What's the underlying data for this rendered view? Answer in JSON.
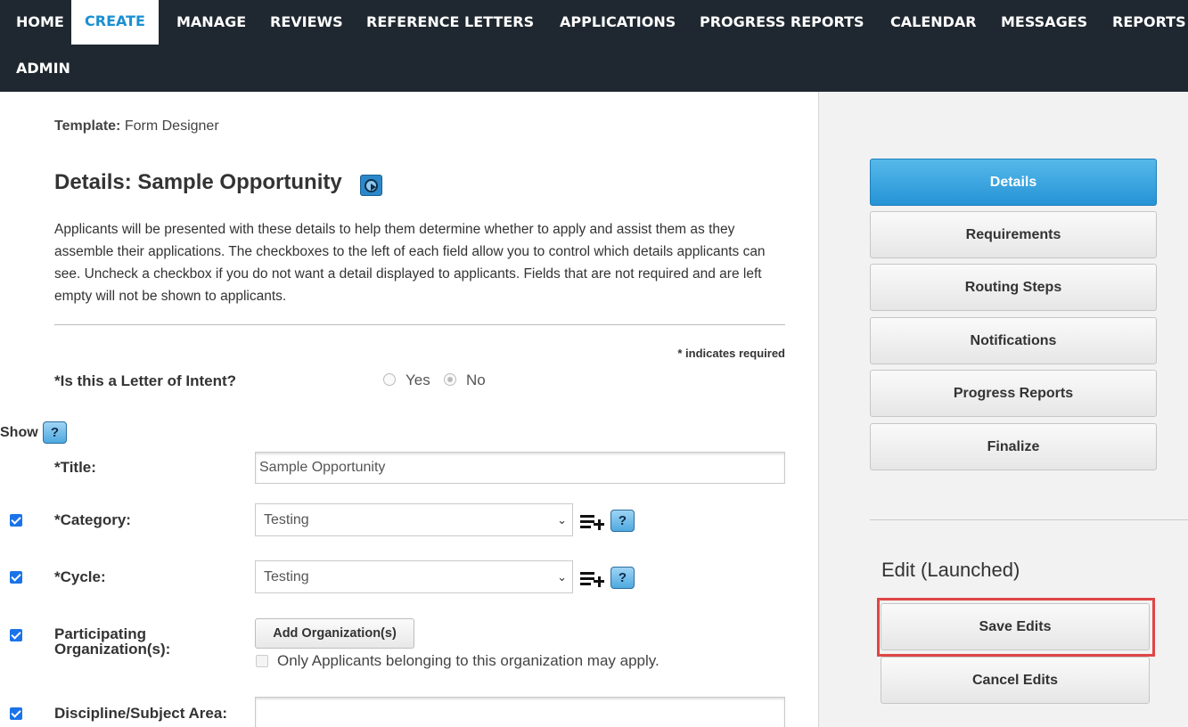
{
  "nav": {
    "items": [
      "HOME",
      "CREATE",
      "MANAGE",
      "REVIEWS",
      "REFERENCE LETTERS",
      "APPLICATIONS",
      "PROGRESS REPORTS",
      "CALENDAR",
      "MESSAGES",
      "REPORTS",
      "ADMIN"
    ],
    "active": "CREATE"
  },
  "header": {
    "template_label": "Template:",
    "template_value": "Form Designer",
    "title": "Details: Sample Opportunity"
  },
  "description": "Applicants will be presented with these details to help them determine whether to apply and assist them as they assemble their applications. The checkboxes to the left of each field allow you to control which details applicants can see. Uncheck a checkbox if you do not want a detail displayed to applicants. Fields that are not required and are left empty will not be shown to applicants.",
  "required_note": "* indicates required",
  "letter_of_intent": {
    "label": "*Is this a Letter of Intent?",
    "options": [
      "Yes",
      "No"
    ],
    "selected": "No"
  },
  "show_label": "Show",
  "help_glyph": "?",
  "fields": {
    "title": {
      "label": "*Title:",
      "value": "Sample Opportunity"
    },
    "category": {
      "label": "*Category:",
      "value": "Testing",
      "show": true
    },
    "cycle": {
      "label": "*Cycle:",
      "value": "Testing",
      "show": true
    },
    "participating_orgs": {
      "label_line1": "Participating",
      "label_line2": "Organization(s):",
      "button": "Add Organization(s)",
      "restriction_label": "Only Applicants belonging to this organization may apply.",
      "restriction_checked": false,
      "show": true
    },
    "discipline": {
      "label": "Discipline/Subject Area:",
      "value": "",
      "show": true
    }
  },
  "sidebar": {
    "steps": [
      "Details",
      "Requirements",
      "Routing Steps",
      "Notifications",
      "Progress Reports",
      "Finalize"
    ],
    "active_step": "Details",
    "edit_status": "Edit (Launched)",
    "save_label": "Save Edits",
    "cancel_label": "Cancel Edits"
  },
  "colors": {
    "nav_bg": "#1f2830",
    "accent": "#1a8fd0",
    "highlight": "#e04646"
  }
}
